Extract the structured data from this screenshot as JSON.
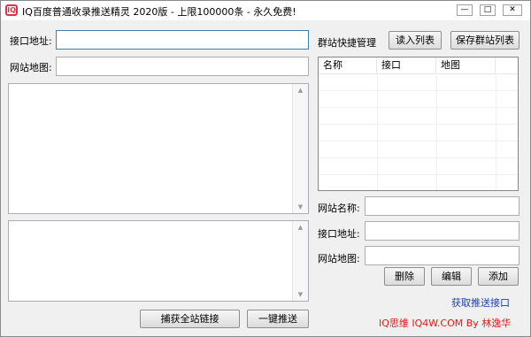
{
  "window": {
    "title": "IQ百度普通收录推送精灵 2020版 - 上限100000条 - 永久免费!",
    "icon_text": "IQ",
    "minimize": "—",
    "maximize": "□",
    "close": "✕"
  },
  "left": {
    "api_label": "接口地址:",
    "api_value": "",
    "sitemap_label": "网站地图:",
    "sitemap_value": ""
  },
  "right": {
    "group_title": "群站快捷管理",
    "read_list_button": "读入列表",
    "save_list_button": "保存群站列表",
    "table_headers": [
      "名称",
      "接口",
      "地图"
    ],
    "site_name_label": "网站名称:",
    "site_name_value": "",
    "site_api_label": "接口地址:",
    "site_api_value": "",
    "site_map_label": "网站地图:",
    "site_map_value": "",
    "delete_button": "删除",
    "edit_button": "编辑",
    "add_button": "添加",
    "get_api_link": "获取推送接口",
    "footer": "IQ思维 IQ4W.COM  By 林逸华"
  },
  "bottom": {
    "capture_button": "捕获全站链接",
    "push_button": "一键推送"
  },
  "colors": {
    "accent_icon": "#e0304a",
    "link": "#1a3fb5",
    "footer": "#e01a1a"
  },
  "icons": [
    "app-logo-icon",
    "minimize-icon",
    "maximize-icon",
    "close-icon",
    "scroll-up-icon",
    "scroll-down-icon"
  ]
}
